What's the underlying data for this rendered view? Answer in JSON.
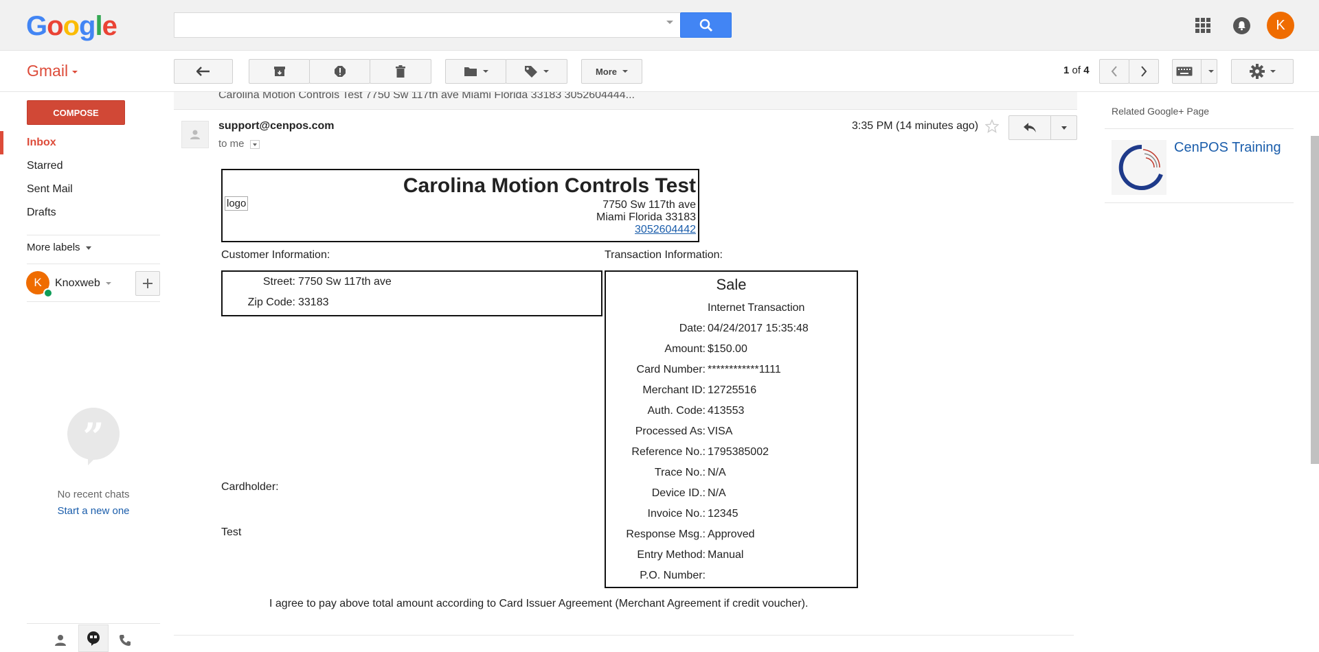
{
  "topbar": {
    "logo_letters": [
      "G",
      "o",
      "o",
      "g",
      "l",
      "e"
    ],
    "logo_colors": [
      "#4285f4",
      "#ea4335",
      "#fbbc05",
      "#4285f4",
      "#34a853",
      "#ea4335"
    ],
    "search": {
      "value": "",
      "placeholder": ""
    },
    "search_icon": "search-icon",
    "apps_icon": "apps-grid-icon",
    "notifications_icon": "bell-icon",
    "account_initial": "K"
  },
  "toolbar": {
    "gmail_label": "Gmail",
    "back_icon": "arrow-left-icon",
    "archive_icon": "archive-icon",
    "spam_icon": "report-spam-icon",
    "delete_icon": "trash-icon",
    "move_icon": "folder-icon",
    "labels_icon": "tag-icon",
    "more_label": "More",
    "pager": {
      "current": "1",
      "of_word": "of",
      "total": "4"
    },
    "keyboard_icon": "keyboard-icon",
    "settings_icon": "gear-icon"
  },
  "sidebar": {
    "compose_label": "COMPOSE",
    "nav": [
      "Inbox",
      "Starred",
      "Sent Mail",
      "Drafts"
    ],
    "more_labels": "More labels",
    "account": {
      "initial": "K",
      "name": "Knoxweb"
    },
    "chat": {
      "no_recent": "No recent chats",
      "start_new": "Start a new one"
    }
  },
  "email": {
    "collapsed_preview": "Carolina Motion Controls Test 7750 Sw 117th ave Miami Florida 33183 3052604444...",
    "sender": "support@cenpos.com",
    "to": "to me",
    "time": "3:35 PM (14 minutes ago)"
  },
  "receipt": {
    "logo_placeholder": "logo",
    "merchant_name": "Carolina Motion Controls Test",
    "address_line1": "7750 Sw 117th ave",
    "address_line2": "Miami Florida 33183",
    "phone": "3052604442",
    "customer_heading": "Customer Information:",
    "transaction_heading": "Transaction Information:",
    "customer_fields": [
      {
        "label": "Street:",
        "value": "7750 Sw 117th ave"
      },
      {
        "label": "Zip Code:",
        "value": "33183"
      }
    ],
    "transaction_type": "Sale",
    "transaction_channel": "Internet Transaction",
    "transaction_fields": [
      {
        "label": "Date:",
        "value": "04/24/2017 15:35:48"
      },
      {
        "label": "Amount:",
        "value": "$150.00"
      },
      {
        "label": "Card Number:",
        "value": "************1111"
      },
      {
        "label": "Merchant ID:",
        "value": "12725516"
      },
      {
        "label": "Auth. Code:",
        "value": "413553"
      },
      {
        "label": "Processed As:",
        "value": "VISA"
      },
      {
        "label": "Reference No.:",
        "value": "1795385002"
      },
      {
        "label": "Trace No.:",
        "value": "N/A"
      },
      {
        "label": "Device ID.:",
        "value": "N/A"
      },
      {
        "label": "Invoice No.:",
        "value": "12345"
      },
      {
        "label": "Response Msg.:",
        "value": "Approved"
      },
      {
        "label": "Entry Method:",
        "value": "Manual"
      },
      {
        "label": "P.O. Number:",
        "value": ""
      }
    ],
    "cardholder_label": "Cardholder:",
    "cardholder_name": "Test",
    "agreement": "I agree to pay above total amount according to Card Issuer Agreement (Merchant Agreement if credit voucher)."
  },
  "right_panel": {
    "heading": "Related Google+ Page",
    "page_name": "CenPOS Training"
  }
}
